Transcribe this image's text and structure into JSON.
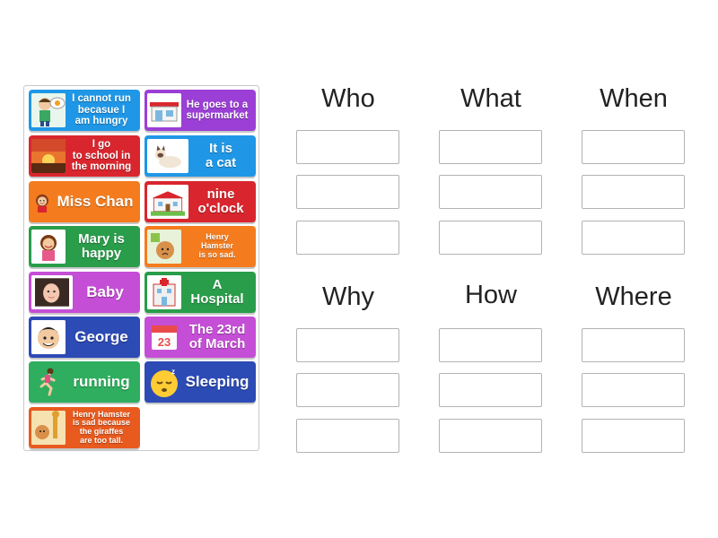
{
  "tray": {
    "cards": [
      {
        "id": "c1",
        "text": "I cannot run\nbecasue I\nam hungry",
        "color": "#1f97e6",
        "icon": "boy-hungry-icon"
      },
      {
        "id": "c2",
        "text": "He goes to a\nsupermarket",
        "color": "#9b3fd6",
        "icon": "supermarket-icon"
      },
      {
        "id": "c3",
        "text": "I go\nto school in\nthe morning",
        "color": "#d9262e",
        "icon": "sunrise-icon"
      },
      {
        "id": "c4",
        "text": "It is\na cat",
        "color": "#1f97e6",
        "icon": "cat-icon"
      },
      {
        "id": "c5",
        "text": "Miss Chan",
        "color": "#f47c1e",
        "icon": "woman-icon"
      },
      {
        "id": "c6",
        "text": "nine\no'clock",
        "color": "#d9262e",
        "icon": "school-building-icon"
      },
      {
        "id": "c7",
        "text": "Mary is\nhappy",
        "color": "#2a9d4a",
        "icon": "happy-girl-icon"
      },
      {
        "id": "c8",
        "text": "Henry\nHamster\nis so sad.",
        "color": "#f47c1e",
        "icon": "sad-hamster-icon"
      },
      {
        "id": "c9",
        "text": "Baby",
        "color": "#c54ed6",
        "icon": "baby-photo-icon"
      },
      {
        "id": "c10",
        "text": "A\nHospital",
        "color": "#2a9d4a",
        "icon": "hospital-icon"
      },
      {
        "id": "c11",
        "text": "George",
        "color": "#2d4bb5",
        "icon": "boy-face-icon"
      },
      {
        "id": "c12",
        "text": "The 23rd\nof March",
        "color": "#c54ed6",
        "icon": "calendar-icon"
      },
      {
        "id": "c13",
        "text": "running",
        "color": "#2fae5f",
        "icon": "runner-icon"
      },
      {
        "id": "c14",
        "text": "Sleeping",
        "color": "#2d4bb5",
        "icon": "sleeping-face-icon"
      },
      {
        "id": "c15",
        "text": "Henry Hamster\nis sad because\nthe giraffes\nare too tall.",
        "color": "#e85a1e",
        "icon": "hamster-giraffe-icon"
      }
    ]
  },
  "groups": [
    {
      "id": "who",
      "heading": "Who"
    },
    {
      "id": "what",
      "heading": "What"
    },
    {
      "id": "when",
      "heading": "When"
    },
    {
      "id": "why",
      "heading": "Why"
    },
    {
      "id": "how",
      "heading": "How"
    },
    {
      "id": "where",
      "heading": "Where"
    }
  ]
}
